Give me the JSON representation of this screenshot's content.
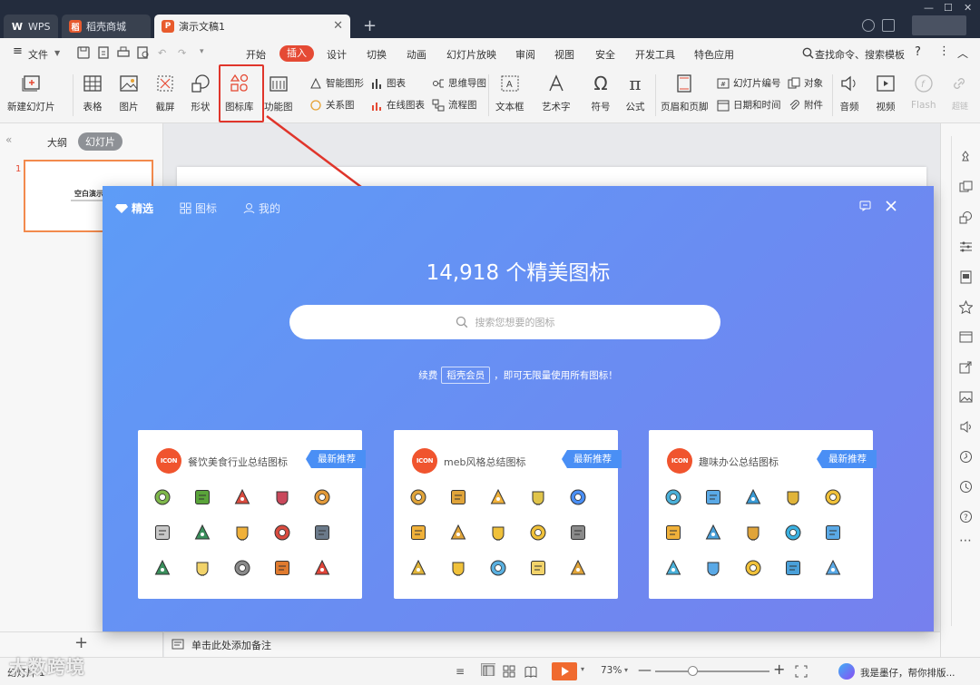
{
  "titlebar": {
    "tabs": [
      {
        "label": "WPS",
        "logo": "W"
      },
      {
        "label": "稻壳商城"
      },
      {
        "label": "演示文稿1"
      }
    ]
  },
  "menubar": {
    "file": "文件",
    "items": [
      "开始",
      "插入",
      "设计",
      "切换",
      "动画",
      "幻灯片放映",
      "审阅",
      "视图",
      "安全",
      "开发工具",
      "特色应用"
    ],
    "search": "查找命令、搜索模板"
  },
  "ribbon": {
    "new_slide": "新建幻灯片",
    "table": "表格",
    "picture": "图片",
    "screenshot": "截屏",
    "shape": "形状",
    "icon_library": "图标库",
    "function_chart": "功能图",
    "smart_graphic": "智能图形",
    "chart": "图表",
    "relation_chart": "关系图",
    "online_chart": "在线图表",
    "mind_map": "思维导图",
    "flow_chart": "流程图",
    "text_box": "文本框",
    "word_art": "艺术字",
    "symbol": "符号",
    "formula": "公式",
    "header_footer": "页眉和页脚",
    "slide_number": "幻灯片编号",
    "date_time": "日期和时间",
    "object": "对象",
    "attachment": "附件",
    "audio": "音频",
    "video": "视频",
    "flash": "Flash",
    "more": "超链"
  },
  "leftpanel": {
    "tab_outline": "大纲",
    "tab_slides": "幻灯片",
    "slide_number": "1",
    "thumb_title": "空白演示"
  },
  "notes": {
    "placeholder": "单击此处添加备注"
  },
  "status": {
    "slide_info": "幻灯片 1",
    "zoom": "73%",
    "assistant": "我是墨仔，帮你排版..."
  },
  "watermark": "大数跨境",
  "dialog": {
    "tabs": [
      "精选",
      "图标",
      "我的"
    ],
    "headline": "14,918 个精美图标",
    "search_placeholder": "搜索您想要的图标",
    "promo_prefix": "续费",
    "promo_vip": "稻壳会员",
    "promo_suffix": "，即可无限量使用所有图标！",
    "cards": [
      {
        "badge": "ICON",
        "title": "餐饮美食行业总结图标",
        "tag": "最新推荐",
        "icons": [
          "broccoli-icon",
          "kiwi-icon",
          "cherry-icon",
          "cake-icon",
          "bowl-icon",
          "cheese-icon",
          "tree-icon",
          "star-icon",
          "trophy-icon",
          "chart-frame-icon",
          "sprouts-icon",
          "bulb-icon",
          "notepad-icon",
          "pizza-icon",
          "watermelon-icon"
        ]
      },
      {
        "badge": "ICON",
        "title": "meb风格总结图标",
        "tag": "最新推荐",
        "icons": [
          "team-icon",
          "blocks-icon",
          "cycle-icon",
          "calculator-icon",
          "document-icon",
          "chat-icon",
          "hourglass-icon",
          "pencil-icon",
          "coin-icon",
          "scale-icon",
          "target-icon",
          "magnifier-icon",
          "refresh-icon",
          "pie-chart-icon",
          "cup-icon"
        ]
      },
      {
        "badge": "ICON",
        "title": "趣味办公总结图标",
        "tag": "最新推荐",
        "icons": [
          "presentation-icon",
          "message-icon",
          "target-icon",
          "transfer-icon",
          "trophy-icon",
          "settings-icon",
          "clipboard-icon",
          "search-gear-icon",
          "globe-icon",
          "file-icon",
          "report-icon",
          "network-icon",
          "book-icon",
          "people-icon",
          "idea-head-icon"
        ]
      }
    ]
  },
  "colors": {
    "accent": "#e54a34",
    "highlight_box": "#e0352b",
    "dialog_gradient_start": "#5d9cf7",
    "dialog_gradient_end": "#7680ee",
    "tag_blue": "#4a8ff5"
  }
}
